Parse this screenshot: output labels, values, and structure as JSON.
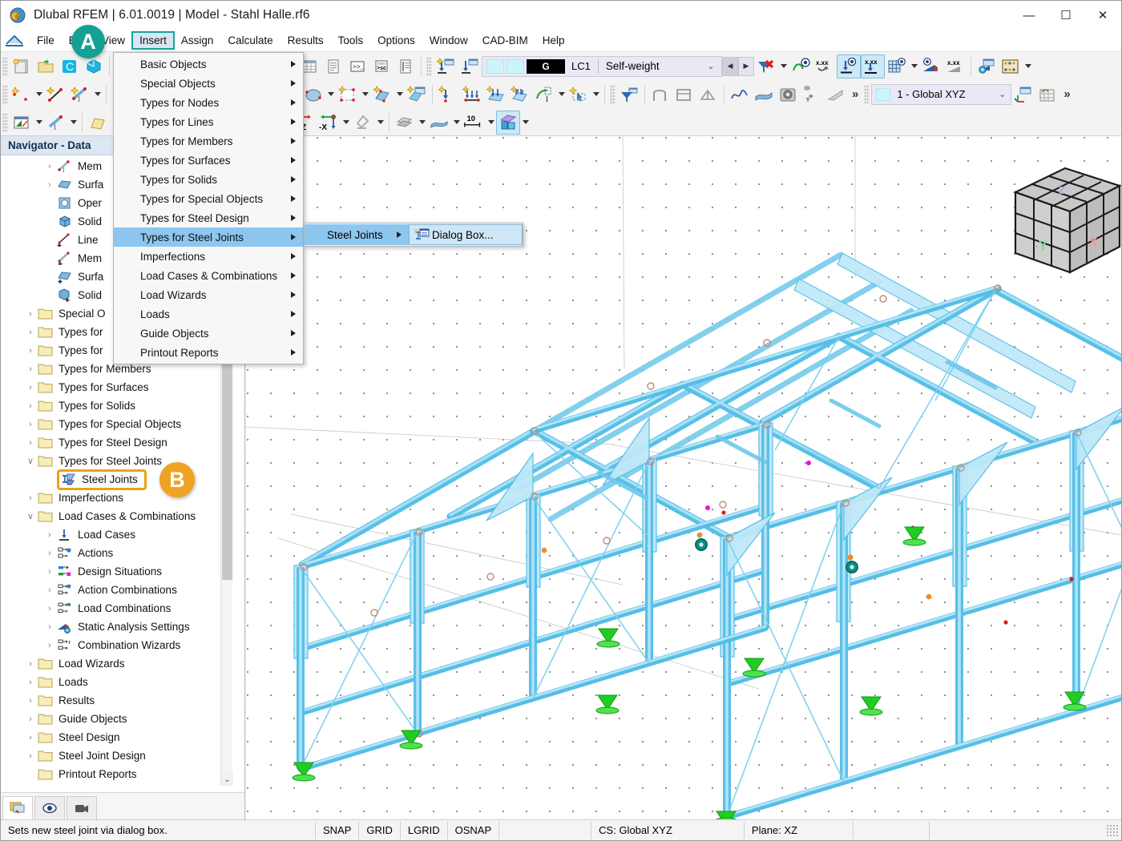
{
  "window": {
    "title": "Dlubal RFEM | 6.01.0019 | Model - Stahl Halle.rf6",
    "icon": "dlubal-logo-icon",
    "minimize": "—",
    "maximize": "☐",
    "close": "✕"
  },
  "menubar": {
    "items": [
      {
        "label": "File",
        "active": false
      },
      {
        "label": "Edit",
        "active": false
      },
      {
        "label": "View",
        "active": false
      },
      {
        "label": "Insert",
        "active": true
      },
      {
        "label": "Assign",
        "active": false
      },
      {
        "label": "Calculate",
        "active": false
      },
      {
        "label": "Results",
        "active": false
      },
      {
        "label": "Tools",
        "active": false
      },
      {
        "label": "Options",
        "active": false
      },
      {
        "label": "Window",
        "active": false
      },
      {
        "label": "CAD-BIM",
        "active": false
      },
      {
        "label": "Help",
        "active": false
      }
    ]
  },
  "insert_menu": {
    "items": [
      {
        "label": "Basic Objects",
        "submenu": true,
        "highlighted": false
      },
      {
        "label": "Special Objects",
        "submenu": true,
        "highlighted": false
      },
      {
        "label": "Types for Nodes",
        "submenu": true,
        "highlighted": false
      },
      {
        "label": "Types for Lines",
        "submenu": true,
        "highlighted": false
      },
      {
        "label": "Types for Members",
        "submenu": true,
        "highlighted": false
      },
      {
        "label": "Types for Surfaces",
        "submenu": true,
        "highlighted": false
      },
      {
        "label": "Types for Solids",
        "submenu": true,
        "highlighted": false
      },
      {
        "label": "Types for Special Objects",
        "submenu": true,
        "highlighted": false
      },
      {
        "label": "Types for Steel Design",
        "submenu": true,
        "highlighted": false
      },
      {
        "label": "Types for Steel Joints",
        "submenu": true,
        "highlighted": true
      },
      {
        "label": "Imperfections",
        "submenu": true,
        "highlighted": false
      },
      {
        "label": "Load Cases & Combinations",
        "submenu": true,
        "highlighted": false
      },
      {
        "label": "Load Wizards",
        "submenu": true,
        "highlighted": false
      },
      {
        "label": "Loads",
        "submenu": true,
        "highlighted": false
      },
      {
        "label": "Guide Objects",
        "submenu": true,
        "highlighted": false
      },
      {
        "label": "Printout Reports",
        "submenu": true,
        "highlighted": false
      }
    ]
  },
  "submenu": {
    "parent_label": "Steel Joints",
    "item_label": "Dialog Box...",
    "item_icon": "steel-joint-dialog-icon"
  },
  "navigator": {
    "title": "Navigator - Data",
    "tree": [
      {
        "label": "Mem",
        "indent": 2,
        "expander": "›",
        "icon": "member-icon"
      },
      {
        "label": "Surfa",
        "indent": 2,
        "expander": "›",
        "icon": "surface-icon"
      },
      {
        "label": "Oper",
        "indent": 2,
        "expander": "",
        "icon": "opening-icon"
      },
      {
        "label": "Solid",
        "indent": 2,
        "expander": "",
        "icon": "solid-icon"
      },
      {
        "label": "Line ",
        "indent": 2,
        "expander": "",
        "icon": "line-set-icon"
      },
      {
        "label": "Mem",
        "indent": 2,
        "expander": "",
        "icon": "member-set-icon"
      },
      {
        "label": "Surfa",
        "indent": 2,
        "expander": "",
        "icon": "surface-set-icon"
      },
      {
        "label": "Solid",
        "indent": 2,
        "expander": "",
        "icon": "solid-set-icon"
      },
      {
        "label": "Special O",
        "indent": 1,
        "expander": "›",
        "icon": "folder-icon"
      },
      {
        "label": "Types for",
        "indent": 1,
        "expander": "›",
        "icon": "folder-icon"
      },
      {
        "label": "Types for",
        "indent": 1,
        "expander": "›",
        "icon": "folder-icon"
      },
      {
        "label": "Types for Members",
        "indent": 1,
        "expander": "›",
        "icon": "folder-icon"
      },
      {
        "label": "Types for Surfaces",
        "indent": 1,
        "expander": "›",
        "icon": "folder-icon"
      },
      {
        "label": "Types for Solids",
        "indent": 1,
        "expander": "›",
        "icon": "folder-icon"
      },
      {
        "label": "Types for Special Objects",
        "indent": 1,
        "expander": "›",
        "icon": "folder-icon"
      },
      {
        "label": "Types for Steel Design",
        "indent": 1,
        "expander": "›",
        "icon": "folder-icon"
      },
      {
        "label": "Types for Steel Joints",
        "indent": 1,
        "expander": "∨",
        "icon": "folder-icon"
      },
      {
        "label": "Steel Joints",
        "indent": 2,
        "expander": "",
        "icon": "steel-joint-icon",
        "highlight": true
      },
      {
        "label": "Imperfections",
        "indent": 1,
        "expander": "›",
        "icon": "folder-icon"
      },
      {
        "label": "Load Cases & Combinations",
        "indent": 1,
        "expander": "∨",
        "icon": "folder-icon"
      },
      {
        "label": "Load Cases",
        "indent": 2,
        "expander": "›",
        "icon": "load-case-icon"
      },
      {
        "label": "Actions",
        "indent": 2,
        "expander": "›",
        "icon": "action-icon"
      },
      {
        "label": "Design Situations",
        "indent": 2,
        "expander": "›",
        "icon": "design-situation-icon"
      },
      {
        "label": "Action Combinations",
        "indent": 2,
        "expander": "›",
        "icon": "action-combination-icon"
      },
      {
        "label": "Load Combinations",
        "indent": 2,
        "expander": "›",
        "icon": "load-combination-icon"
      },
      {
        "label": "Static Analysis Settings",
        "indent": 2,
        "expander": "›",
        "icon": "static-analysis-icon"
      },
      {
        "label": "Combination Wizards",
        "indent": 2,
        "expander": "›",
        "icon": "combination-wizard-icon"
      },
      {
        "label": "Load Wizards",
        "indent": 1,
        "expander": "›",
        "icon": "folder-icon"
      },
      {
        "label": "Loads",
        "indent": 1,
        "expander": "›",
        "icon": "folder-icon"
      },
      {
        "label": "Results",
        "indent": 1,
        "expander": "›",
        "icon": "folder-icon"
      },
      {
        "label": "Guide Objects",
        "indent": 1,
        "expander": "›",
        "icon": "folder-icon"
      },
      {
        "label": "Steel Design",
        "indent": 1,
        "expander": "›",
        "icon": "folder-icon"
      },
      {
        "label": "Steel Joint Design",
        "indent": 1,
        "expander": "›",
        "icon": "folder-icon"
      },
      {
        "label": "Printout Reports",
        "indent": 1,
        "expander": "",
        "icon": "folder-icon"
      }
    ],
    "footer_tabs": [
      {
        "name": "navigator-data-tab",
        "icon": "data-navigator-icon",
        "active": true
      },
      {
        "name": "navigator-display-tab",
        "icon": "eye-icon",
        "active": false
      },
      {
        "name": "navigator-views-tab",
        "icon": "camera-icon",
        "active": false
      }
    ]
  },
  "toolbar": {
    "loadcase": {
      "tag": "G",
      "id": "LC1",
      "name": "Self-weight",
      "prev": "◀",
      "next": "▶"
    },
    "coordinate_system": {
      "value": "1 - Global XYZ"
    },
    "snap_increment": "10",
    "overflow": "»"
  },
  "view": {
    "nav_cube": {
      "face_left": "-Y",
      "face_right": "X",
      "face_top": "Z"
    }
  },
  "statusbar": {
    "message": "Sets new steel joint via dialog box.",
    "toggles": [
      "SNAP",
      "GRID",
      "LGRID",
      "OSNAP"
    ],
    "cs": "CS: Global XYZ",
    "plane": "Plane: XZ"
  },
  "callouts": [
    {
      "id": "A",
      "label": "A",
      "color": "#13a195"
    },
    {
      "id": "B",
      "label": "B",
      "color": "#f0a322"
    }
  ]
}
